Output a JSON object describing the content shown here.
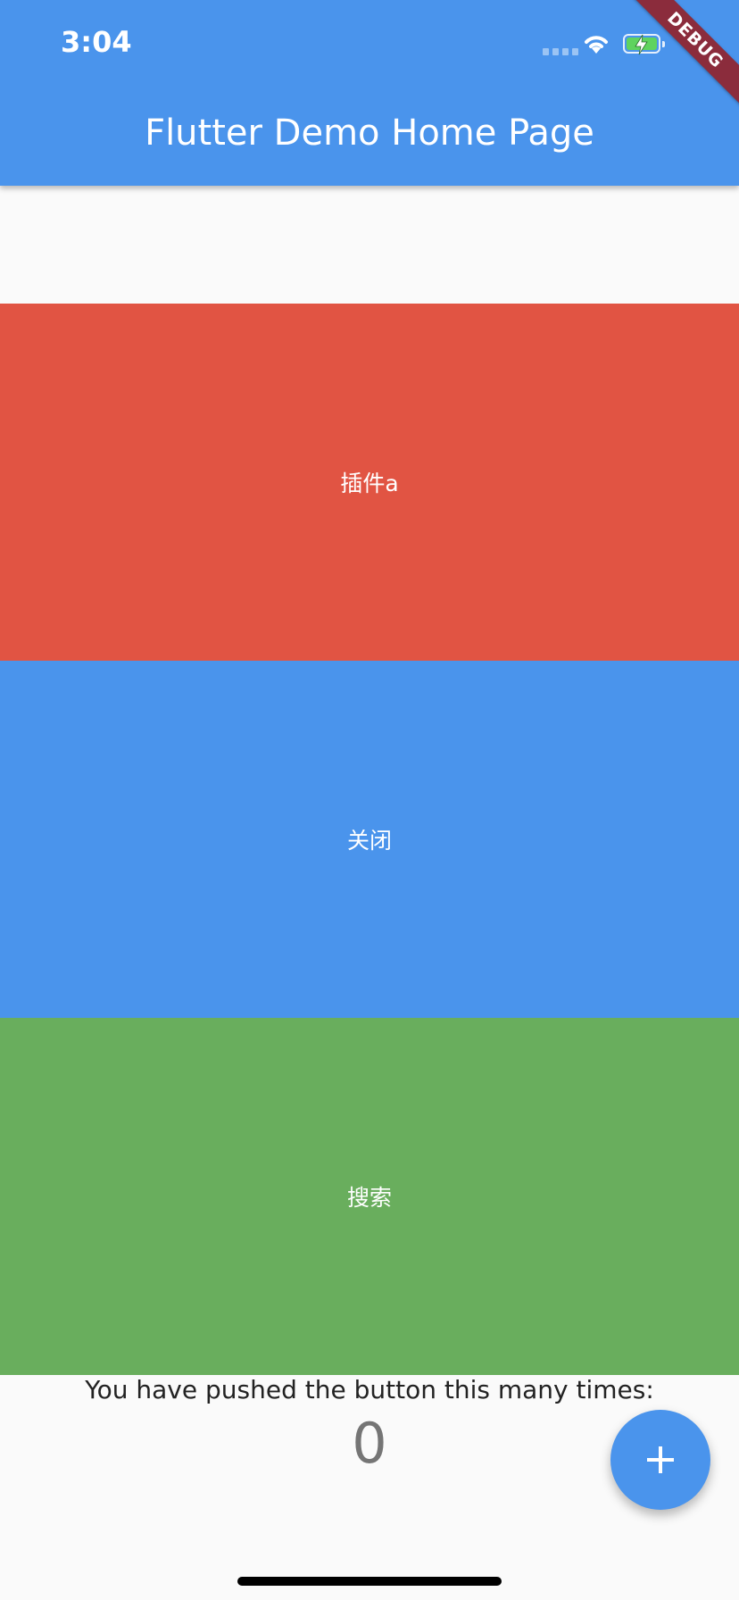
{
  "status_bar": {
    "time": "3:04"
  },
  "app_bar": {
    "title": "Flutter Demo Home Page"
  },
  "debug_banner": {
    "label": "DEBUG"
  },
  "blocks": [
    {
      "label": "插件a",
      "color": "#e15443"
    },
    {
      "label": "关闭",
      "color": "#4a94ec"
    },
    {
      "label": "搜索",
      "color": "#69ae5d"
    }
  ],
  "counter": {
    "description": "You have pushed the button this many times:",
    "value": "0"
  },
  "fab": {
    "icon": "plus-icon"
  },
  "colors": {
    "primary": "#4a94ec",
    "background": "#fafafa",
    "debug_ribbon": "#8b2c3c"
  }
}
